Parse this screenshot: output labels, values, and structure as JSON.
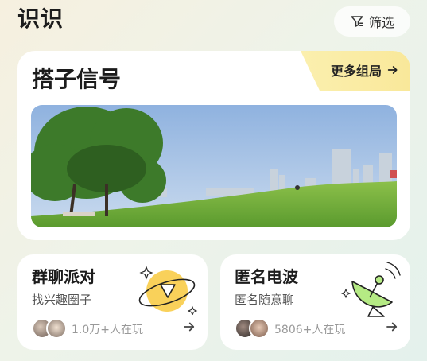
{
  "header": {
    "app_title": "识识",
    "filter_label": "筛选"
  },
  "signal": {
    "title": "搭子信号",
    "more_label": "更多组局"
  },
  "cards": [
    {
      "title": "群聊派对",
      "subtitle": "找兴趣圈子",
      "online": "1.0万+人在玩"
    },
    {
      "title": "匿名电波",
      "subtitle": "匿名随意聊",
      "online": "5806+人在玩"
    }
  ],
  "colors": {
    "accent_yellow": "#fbe27a",
    "planet_yellow": "#f9d15a",
    "satellite_green": "#b5ea84"
  },
  "icons": [
    "filter-icon",
    "arrow-right-icon",
    "planet-play-icon",
    "satellite-dish-icon",
    "sparkle-icon"
  ]
}
